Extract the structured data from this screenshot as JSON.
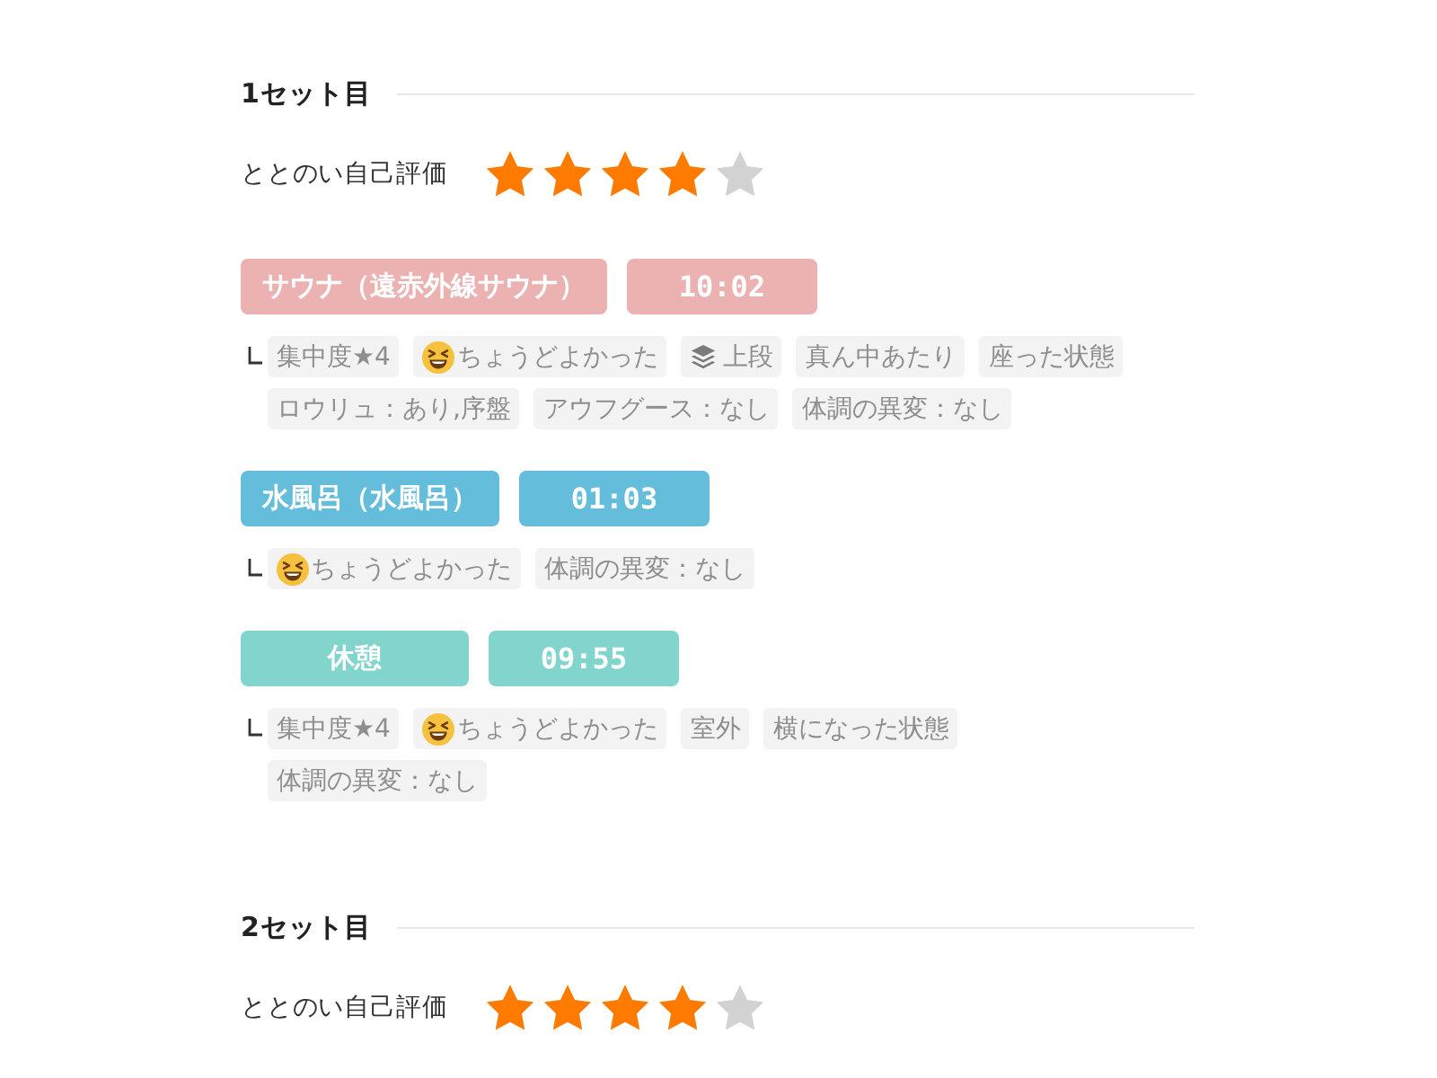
{
  "sets": [
    {
      "title": "1セット目",
      "rating": {
        "label": "ととのい自己評価",
        "stars": 4
      },
      "steps": [
        {
          "name": "サウナ（遠赤外線サウナ）",
          "time": "10:02",
          "color": "#ebb2b1",
          "tags": [
            {
              "kind": "text",
              "text": "集中度★4"
            },
            {
              "kind": "emoji",
              "text": "ちょうどよかった"
            },
            {
              "kind": "layers",
              "text": "上段"
            },
            {
              "kind": "text",
              "text": "真ん中あたり"
            },
            {
              "kind": "text",
              "text": "座った状態"
            },
            {
              "kind": "text",
              "text": "ロウリュ：あり,序盤"
            },
            {
              "kind": "text",
              "text": "アウフグース：なし"
            },
            {
              "kind": "text",
              "text": "体調の異変：なし"
            }
          ]
        },
        {
          "name": "水風呂（水風呂）",
          "time": "01:03",
          "color": "#64bddb",
          "tags": [
            {
              "kind": "emoji",
              "text": "ちょうどよかった"
            },
            {
              "kind": "text",
              "text": "体調の異変：なし"
            }
          ]
        },
        {
          "name": "休憩",
          "time": "09:55",
          "color": "#82d5cc",
          "tags": [
            {
              "kind": "text",
              "text": "集中度★4"
            },
            {
              "kind": "emoji",
              "text": "ちょうどよかった"
            },
            {
              "kind": "text",
              "text": "室外"
            },
            {
              "kind": "text",
              "text": "横になった状態"
            },
            {
              "kind": "text",
              "text": "体調の異変：なし"
            }
          ]
        }
      ]
    },
    {
      "title": "2セット目",
      "rating": {
        "label": "ととのい自己評価",
        "stars": 4
      }
    }
  ]
}
